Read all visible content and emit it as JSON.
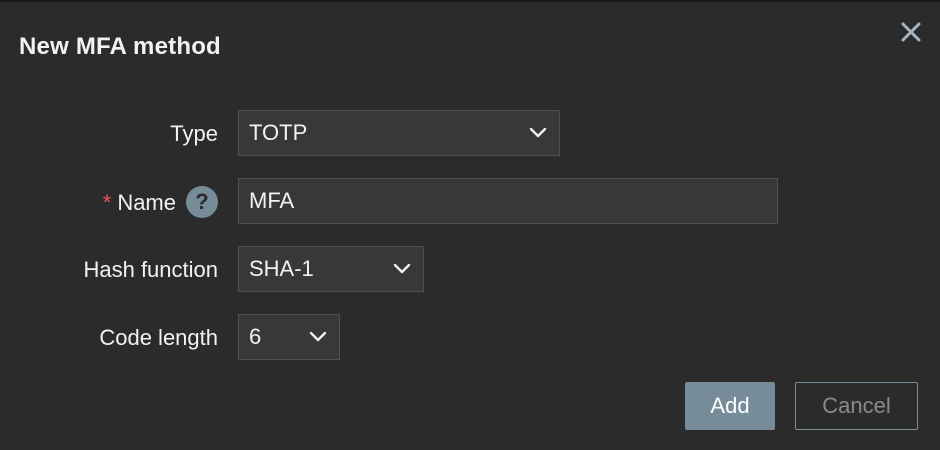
{
  "dialog": {
    "title": "New MFA method",
    "close_icon": "close-icon"
  },
  "form": {
    "type": {
      "label": "Type",
      "value": "TOTP"
    },
    "name": {
      "label": "Name",
      "required_mark": "*",
      "help_glyph": "?",
      "value": "MFA"
    },
    "hash_function": {
      "label": "Hash function",
      "value": "SHA-1"
    },
    "code_length": {
      "label": "Code length",
      "value": "6"
    }
  },
  "buttons": {
    "add_label": "Add",
    "cancel_label": "Cancel"
  },
  "colors": {
    "background": "#2b2b2b",
    "field_bg": "#383838",
    "accent": "#768d99",
    "required": "#e45959"
  }
}
